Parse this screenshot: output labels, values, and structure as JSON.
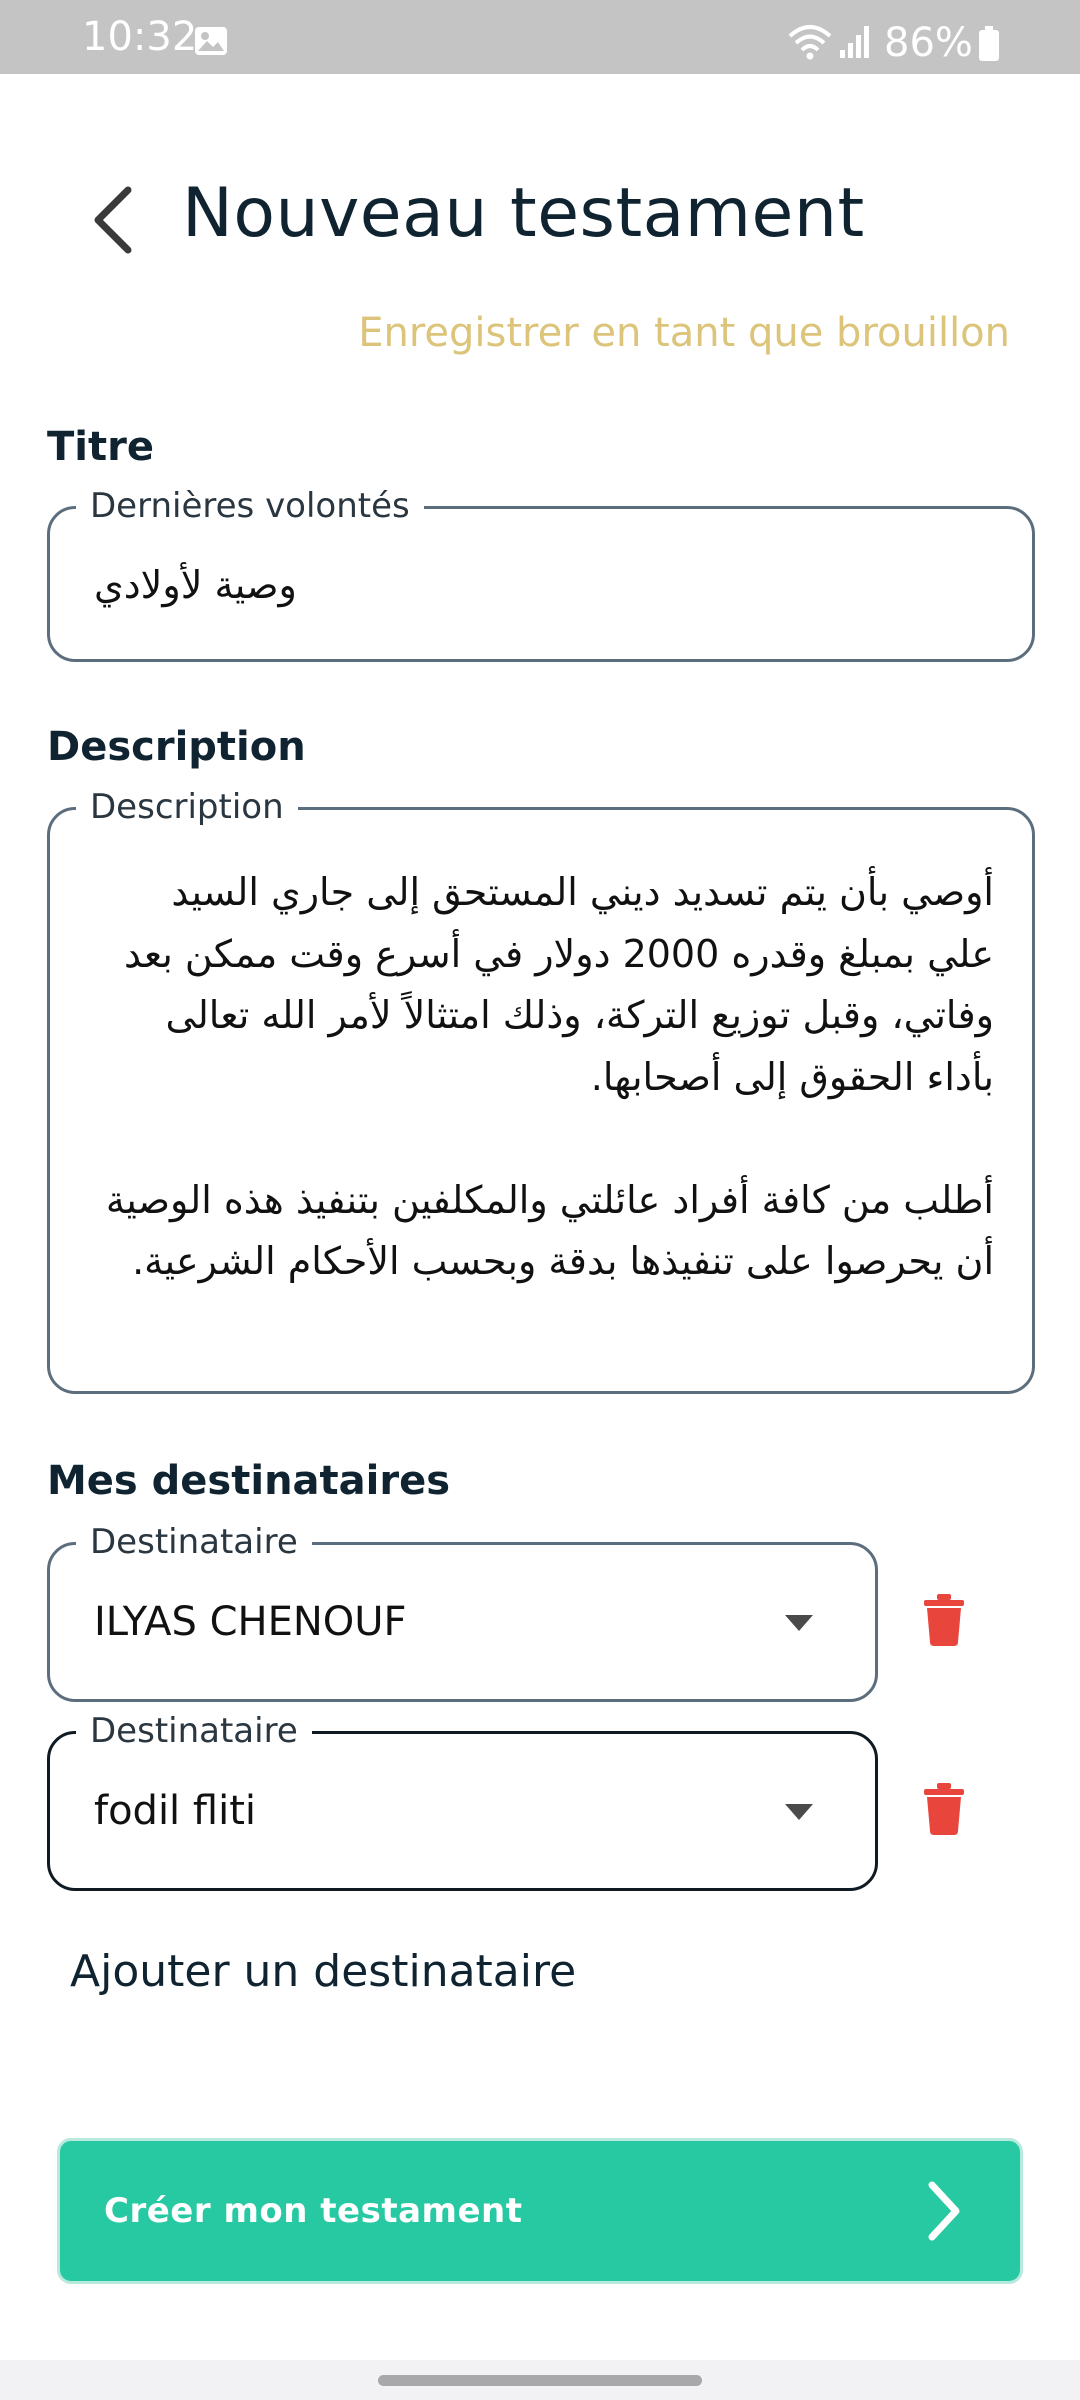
{
  "status_bar": {
    "time": "10:32",
    "battery": "86%"
  },
  "header": {
    "title": "Nouveau testament",
    "draft_link": "Enregistrer en tant que brouillon"
  },
  "title_section": {
    "label": "Titre",
    "field_legend": "Dernières volontés",
    "value": "وصية لأولادي"
  },
  "description_section": {
    "label": "Description",
    "field_legend": "Description",
    "value": "أوصي بأن يتم تسديد ديني المستحق إلى جاري السيد علي بمبلغ وقدره 2000 دولار في أسرع وقت ممكن بعد وفاتي، وقبل توزيع التركة، وذلك امتثالاً لأمر الله تعالى بأداء الحقوق إلى أصحابها.\n\nأطلب من كافة أفراد عائلتي والمكلفين بتنفيذ هذه الوصية أن يحرصوا على تنفيذها بدقة وبحسب الأحكام الشرعية."
  },
  "recipients_section": {
    "label": "Mes destinataires",
    "recipients": [
      {
        "legend": "Destinataire",
        "value": "ILYAS CHENOUF"
      },
      {
        "legend": "Destinataire",
        "value": "fodil fliti"
      }
    ],
    "add_label": "Ajouter un destinataire"
  },
  "create_button": {
    "label": "Créer mon testament"
  },
  "colors": {
    "accent": "#27c9a2",
    "draft_link": "#dcc47a",
    "delete": "#e8453c",
    "text": "#0f2330"
  }
}
